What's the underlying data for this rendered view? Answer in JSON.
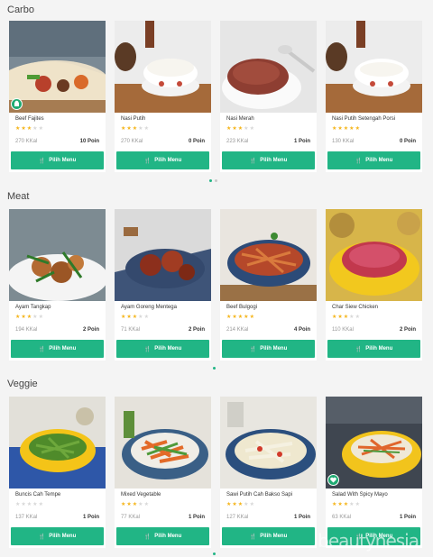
{
  "sections": [
    {
      "title": "Carbo",
      "items": [
        {
          "name": "Beef Fajites",
          "rating": 3,
          "kcal": "270 KKal",
          "poin": "10 Poin",
          "button": "Pilih Menu",
          "badge": "chef-hat-icon"
        },
        {
          "name": "Nasi Putih",
          "rating": 3,
          "kcal": "270 KKal",
          "poin": "0 Poin",
          "button": "Pilih Menu"
        },
        {
          "name": "Nasi Merah",
          "rating": 3,
          "kcal": "223 KKal",
          "poin": "1 Poin",
          "button": "Pilih Menu"
        },
        {
          "name": "Nasi Putih Setengah Porsi",
          "rating": 5,
          "kcal": "130 KKal",
          "poin": "0 Poin",
          "button": "Pilih Menu"
        }
      ]
    },
    {
      "title": "Meat",
      "items": [
        {
          "name": "Ayam Tangkap",
          "rating": 3,
          "kcal": "194 KKal",
          "poin": "2 Poin",
          "button": "Pilih Menu"
        },
        {
          "name": "Ayam Goreng Mentega",
          "rating": 3,
          "kcal": "71 KKal",
          "poin": "2 Poin",
          "button": "Pilih Menu"
        },
        {
          "name": "Beef Bulgogi",
          "rating": 5,
          "kcal": "214 KKal",
          "poin": "4 Poin",
          "button": "Pilih Menu"
        },
        {
          "name": "Char Siew Chicken",
          "rating": 3,
          "kcal": "110 KKal",
          "poin": "2 Poin",
          "button": "Pilih Menu"
        }
      ]
    },
    {
      "title": "Veggie",
      "items": [
        {
          "name": "Buncis Cah Tempe",
          "rating": 0,
          "kcal": "137 KKal",
          "poin": "1 Poin",
          "button": "Pilih Menu"
        },
        {
          "name": "Mixed Vegetable",
          "rating": 3,
          "kcal": "77 KKal",
          "poin": "1 Poin",
          "button": "Pilih Menu"
        },
        {
          "name": "Sawi Putih Cah Bakso Sapi",
          "rating": 3,
          "kcal": "127 KKal",
          "poin": "1 Poin",
          "button": "Pilih Menu"
        },
        {
          "name": "Salad With Spicy Mayo",
          "rating": 3,
          "kcal": "63 KKal",
          "poin": "1 Poin",
          "button": "Pilih Menu",
          "badge": "heart-leaf-icon"
        }
      ]
    }
  ],
  "pagination": {
    "carbo_active": 1,
    "carbo_total": 2,
    "meat_active": 1,
    "meat_total": 1,
    "veggie_active": 1,
    "veggie_total": 1
  },
  "watermark": "beautynesia",
  "colors": {
    "accent": "#21b585",
    "star": "#f5b51b",
    "background": "#f4f4f4"
  }
}
